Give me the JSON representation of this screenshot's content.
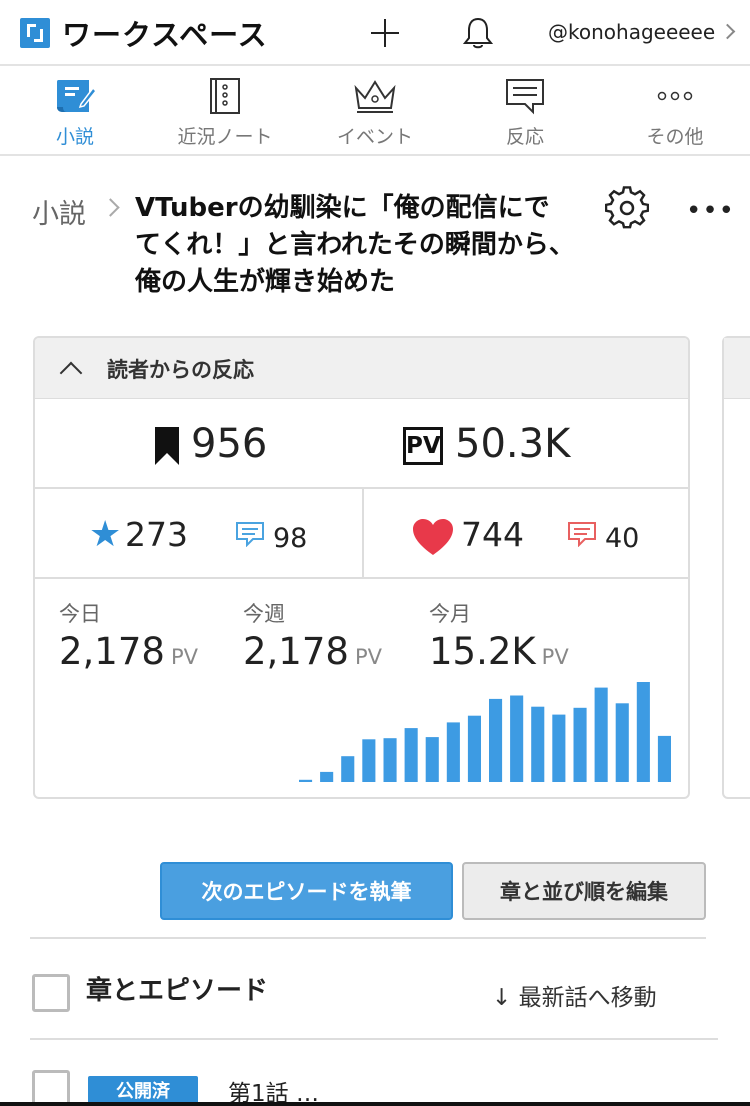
{
  "header": {
    "app_title": "ワークスペース",
    "user": "@konohageeeee",
    "icons": [
      "logo-icon",
      "plus-icon",
      "bell-icon",
      "chevron-right-icon"
    ]
  },
  "nav": {
    "items": [
      {
        "label": "小説",
        "icon": "novel-icon",
        "active": true
      },
      {
        "label": "近況ノート",
        "icon": "notebook-icon",
        "active": false
      },
      {
        "label": "イベント",
        "icon": "crown-icon",
        "active": false
      },
      {
        "label": "反応",
        "icon": "speech-bubble-icon",
        "active": false
      },
      {
        "label": "その他",
        "icon": "more-icon",
        "active": false
      }
    ]
  },
  "breadcrumb": {
    "parent": "小説",
    "title": "VTuberの幼馴染に「俺の配信にでてくれ！」と言われたその瞬間から、俺の人生が輝き始めた"
  },
  "reactions": {
    "header": "読者からの反応",
    "bookmarks": "956",
    "pv_label": "PV",
    "pv_total": "50.3K",
    "stars": "273",
    "star_reviews": "98",
    "hearts": "744",
    "heart_comments": "40",
    "periods": [
      {
        "label": "今日",
        "value": "2,178",
        "unit": "PV"
      },
      {
        "label": "今週",
        "value": "2,178",
        "unit": "PV"
      },
      {
        "label": "今月",
        "value": "15.2K",
        "unit": "PV"
      }
    ]
  },
  "chart_data": {
    "type": "bar",
    "values": [
      2,
      9,
      23,
      38,
      39,
      48,
      40,
      53,
      59,
      74,
      77,
      67,
      60,
      66,
      84,
      70,
      89,
      41
    ],
    "color": "#3d9be3"
  },
  "actions": {
    "write_next": "次のエピソードを執筆",
    "edit_chapters": "章と並び順を編集"
  },
  "episodes": {
    "section_title": "章とエピソード",
    "jump_latest": "↓ 最新話へ移動",
    "first": {
      "status": "公開済",
      "title": "第1話 …"
    }
  },
  "colors": {
    "accent": "#2f8ed6",
    "heart": "#e8394a",
    "comment_red": "#e86060"
  }
}
